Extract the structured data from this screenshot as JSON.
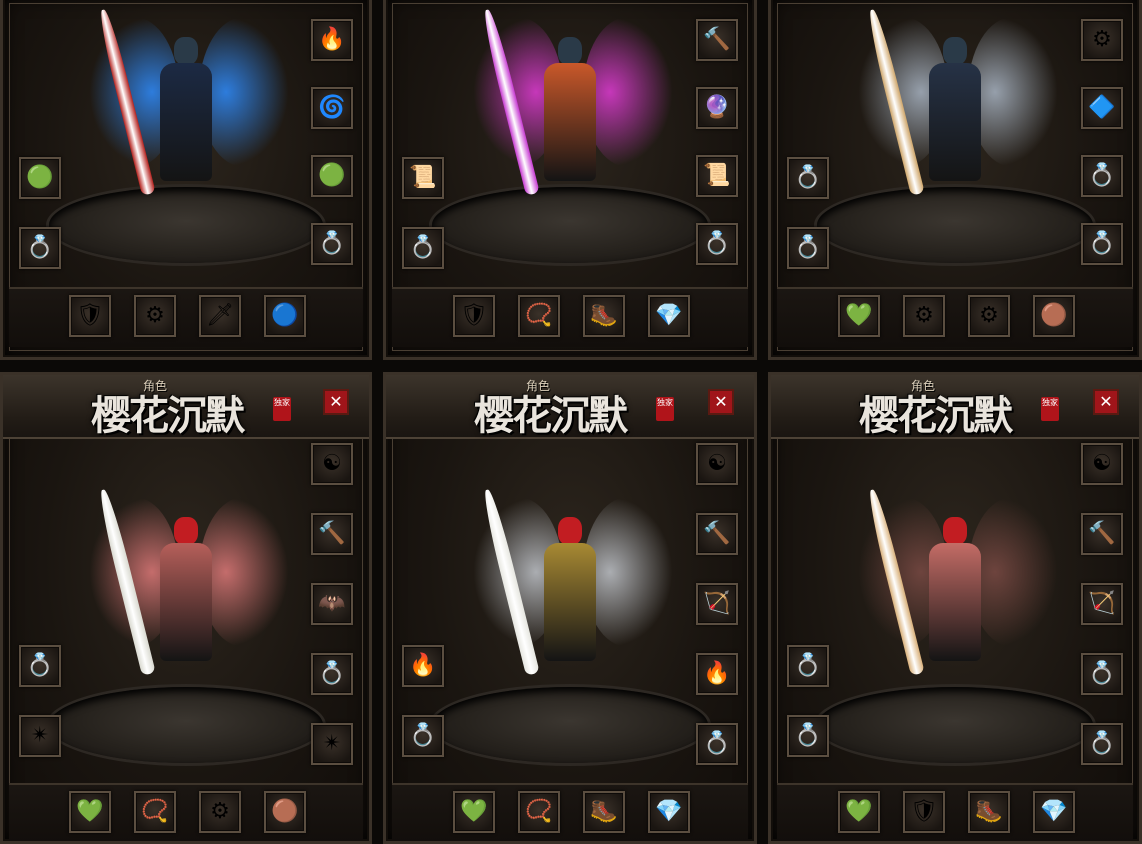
{
  "panels": [
    {
      "title": "",
      "tab": "",
      "seal": "",
      "close": "",
      "theme": "blue",
      "slot_icons": {
        "left": [
          "🟢",
          "💍"
        ],
        "right": [
          "🔥",
          "🌀",
          "🟢",
          "💍"
        ],
        "bottom": [
          "🛡",
          "⚙",
          "🗡",
          "🔵"
        ]
      }
    },
    {
      "title": "",
      "tab": "",
      "seal": "",
      "close": "",
      "theme": "pink",
      "slot_icons": {
        "left": [
          "📜",
          "💍"
        ],
        "right": [
          "🔨",
          "🔮",
          "📜",
          "💍"
        ],
        "bottom": [
          "🛡",
          "📿",
          "🥾",
          "💎"
        ]
      }
    },
    {
      "title": "",
      "tab": "",
      "seal": "",
      "close": "",
      "theme": "silver",
      "slot_icons": {
        "left": [
          "💍",
          "💍"
        ],
        "right": [
          "⚙",
          "🔷",
          "💍",
          "💍"
        ],
        "bottom": [
          "💚",
          "⚙",
          "⚙",
          "🟤"
        ]
      }
    },
    {
      "title": "樱花沉默",
      "tab": "角色",
      "seal": "独家",
      "close": "✕",
      "theme": "rose",
      "slot_icons": {
        "left": [
          "💍",
          "✴"
        ],
        "right": [
          "☯",
          "🔨",
          "🦇",
          "💍",
          "✴"
        ],
        "bottom": [
          "💚",
          "📿",
          "⚙",
          "🟤"
        ]
      }
    },
    {
      "title": "樱花沉默",
      "tab": "角色",
      "seal": "独家",
      "close": "✕",
      "theme": "gold",
      "slot_icons": {
        "left": [
          "🔥",
          "💍"
        ],
        "right": [
          "☯",
          "🔨",
          "🏹",
          "🔥",
          "💍"
        ],
        "bottom": [
          "💚",
          "📿",
          "🥾",
          "💎"
        ]
      }
    },
    {
      "title": "樱花沉默",
      "tab": "角色",
      "seal": "独家",
      "close": "✕",
      "theme": "crimson",
      "slot_icons": {
        "left": [
          "💍",
          "💍"
        ],
        "right": [
          "☯",
          "🔨",
          "🏹",
          "💍",
          "💍"
        ],
        "bottom": [
          "💚",
          "🛡",
          "🥾",
          "💎"
        ]
      }
    }
  ],
  "colors": {
    "blue": {
      "wing": "#2f8dff",
      "body": "#1c2a44",
      "weapon": "#b3201c"
    },
    "pink": {
      "wing": "#e23cd6",
      "body": "#c9582a",
      "weapon": "#c73ad2"
    },
    "silver": {
      "wing": "#aab6c5",
      "body": "#263246",
      "weapon": "#cfa66a"
    },
    "rose": {
      "wing": "#e07a7a",
      "body": "#b65f5a",
      "weapon": "#d9d9d0"
    },
    "gold": {
      "wing": "#c2c6cc",
      "body": "#a88a33",
      "weapon": "#e6e6e0"
    },
    "crimson": {
      "wing": "#7a4a44",
      "body": "#c46c66",
      "weapon": "#d9b07a"
    }
  }
}
